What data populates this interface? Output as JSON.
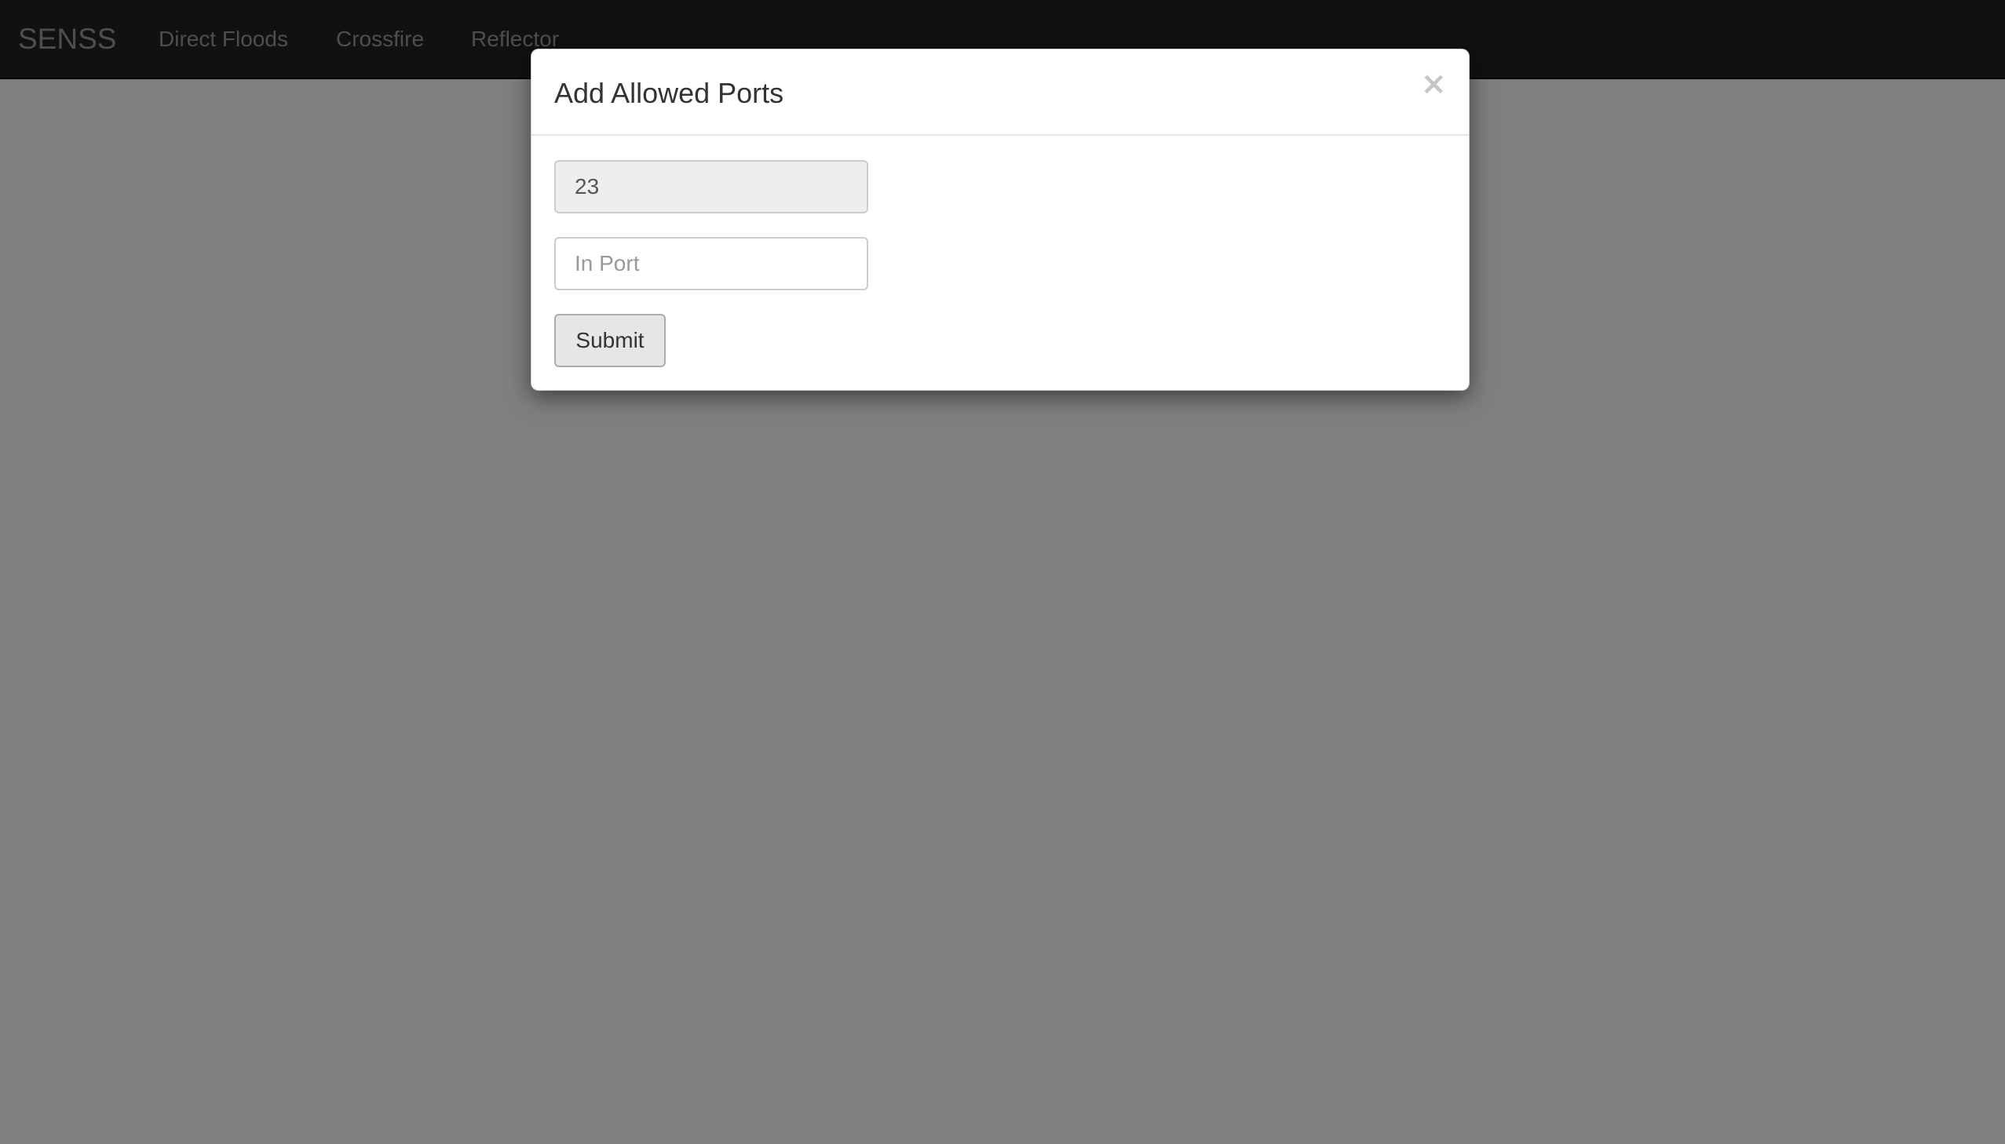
{
  "navbar": {
    "brand": "SENSS",
    "links": [
      {
        "label": "Direct Floods"
      },
      {
        "label": "Crossfire"
      },
      {
        "label": "Reflector"
      }
    ]
  },
  "modal": {
    "title": "Add Allowed Ports",
    "close_label": "×",
    "fields": [
      {
        "value": "23",
        "placeholder": ""
      },
      {
        "value": "",
        "placeholder": "In Port"
      }
    ],
    "submit_label": "Submit"
  },
  "colors": {
    "navbar_background": "#222222",
    "nav_link_text": "#9d9d9d",
    "backdrop": "#000000",
    "modal_background": "#ffffff",
    "filled_input_background": "#eeeeee",
    "submit_button_background": "#e6e6e6"
  }
}
